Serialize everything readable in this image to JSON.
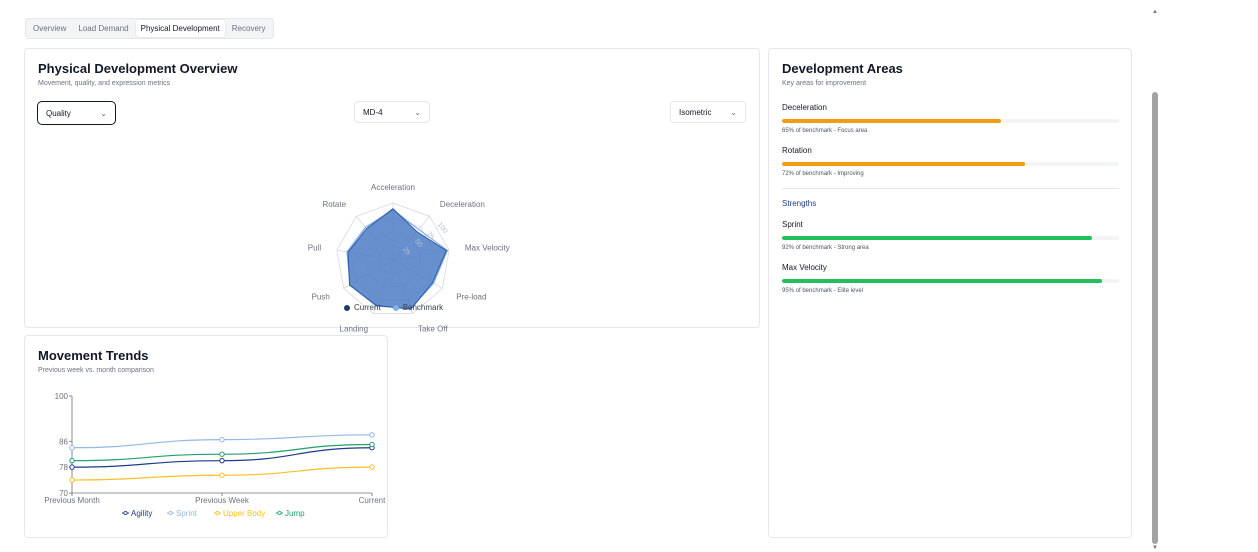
{
  "tabs": [
    {
      "label": "Overview",
      "active": false
    },
    {
      "label": "Load Demand",
      "active": false
    },
    {
      "label": "Physical Development",
      "active": true
    },
    {
      "label": "Recovery",
      "active": false
    }
  ],
  "overview": {
    "title": "Physical Development Overview",
    "subtitle": "Movement, quality, and expression metrics",
    "filters": {
      "quality": "Quality",
      "md": "MD-4",
      "mode": "Isometric"
    },
    "legend": [
      {
        "label": "Current",
        "color": "#1e3a6e"
      },
      {
        "label": "Benchmark",
        "color": "#7eaee8"
      }
    ]
  },
  "radar": {
    "axes": [
      "Acceleration",
      "Deceleration",
      "Max Velocity",
      "Pre-load",
      "Take Off",
      "Landing",
      "Push",
      "Pull",
      "Rotate"
    ],
    "scale_ticks": [
      "0",
      "25",
      "50",
      "75",
      "100"
    ],
    "current": [
      90,
      65,
      95,
      80,
      92,
      85,
      88,
      80,
      72
    ],
    "benchmark": [
      88,
      70,
      97,
      82,
      90,
      86,
      87,
      82,
      75
    ],
    "max": 100,
    "fill_color": "#4d7cc7",
    "line_color": "#7eaee8"
  },
  "trends": {
    "title": "Movement Trends",
    "subtitle": "Previous week vs. month comparison",
    "legend": [
      {
        "label": "Agility",
        "color": "#1e3a8a"
      },
      {
        "label": "Sprint",
        "color": "#93b8ea"
      },
      {
        "label": "Upper Body",
        "color": "#fbbf24"
      },
      {
        "label": "Jump",
        "color": "#22a06b"
      }
    ]
  },
  "chart_data": {
    "type": "line",
    "categories": [
      "Previous Month",
      "Previous Week",
      "Current"
    ],
    "series": [
      {
        "name": "Agility",
        "values": [
          78,
          80,
          84
        ]
      },
      {
        "name": "Sprint",
        "values": [
          84,
          86.5,
          88
        ]
      },
      {
        "name": "Upper Body",
        "values": [
          74,
          75.5,
          78
        ]
      },
      {
        "name": "Jump",
        "values": [
          80,
          82,
          85
        ]
      }
    ],
    "y_ticks": [
      "70",
      "78",
      "86",
      "100"
    ],
    "ylim": [
      70,
      100
    ],
    "xlabel": "",
    "ylabel": ""
  },
  "areas": {
    "title": "Development Areas",
    "subtitle": "Key areas for improvement",
    "improve": [
      {
        "label": "Deceleration",
        "note": "65% of benchmark - Focus area",
        "progress": 0.65,
        "color": "#f39c12"
      },
      {
        "label": "Rotation",
        "note": "72% of benchmark - Improving",
        "progress": 0.72,
        "color": "#f39c12"
      }
    ],
    "strengths_title": "Strengths",
    "strengths": [
      {
        "label": "Sprint",
        "note": "92% of benchmark - Strong area",
        "progress": 0.92,
        "color": "#22c05a"
      },
      {
        "label": "Max Velocity",
        "note": "95% of benchmark - Elite level",
        "progress": 0.95,
        "color": "#22c05a"
      }
    ]
  }
}
